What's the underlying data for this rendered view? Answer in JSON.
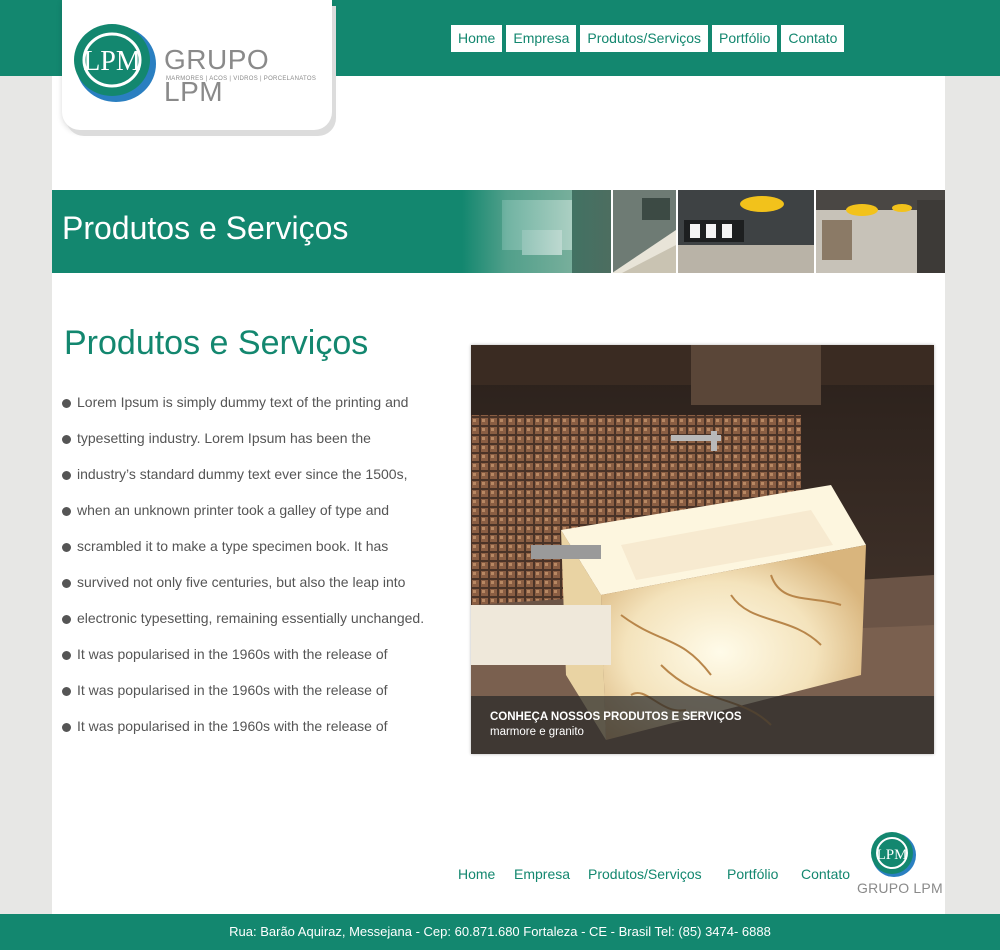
{
  "brand": {
    "name": "GRUPO LPM",
    "tagline": "MARMORES | ACOS | VIDROS | PORCELANATOS",
    "monogram": "LPM"
  },
  "nav": {
    "items": [
      "Home",
      "Empresa",
      "Produtos/Serviços",
      "Portfólio",
      "Contato"
    ]
  },
  "banner": {
    "title": "Produtos e Serviços"
  },
  "main": {
    "title": "Produtos e Serviços",
    "bullets": [
      "Lorem Ipsum is simply dummy text of the printing and",
      "typesetting industry. Lorem Ipsum has been the",
      "industry’s standard dummy text ever since the 1500s,",
      "when an unknown printer took a galley of type and",
      "scrambled it to make a type specimen book. It has",
      "survived not only five centuries, but also the leap into",
      "electronic typesetting, remaining essentially unchanged.",
      "It was popularised in the 1960s with the release of",
      "It was popularised in the 1960s with the release of",
      "It was popularised in the 1960s with the release of"
    ]
  },
  "feature": {
    "caption_title": "CONHEÇA NOSSOS PRODUTOS E SERVIÇOS",
    "caption_subtitle": "marmore e granito"
  },
  "footer": {
    "nav_items": [
      "Home",
      "Empresa",
      "Produtos/Serviços",
      "Portfólio",
      "Contato"
    ],
    "logo_text": "GRUPO LPM",
    "address": "Rua: Barão Aquiraz, Messejana - Cep: 60.871.680 Fortaleza - CE - Brasil Tel: (85) 3474- 6888"
  },
  "colors": {
    "brand_green": "#13876f",
    "logo_blue": "#2a7fc1",
    "text_gray": "#555555"
  }
}
